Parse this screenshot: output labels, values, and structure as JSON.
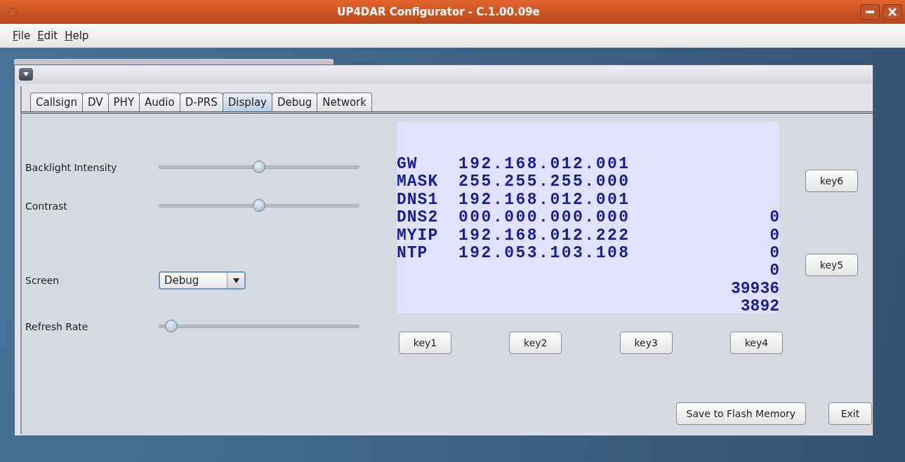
{
  "window": {
    "title": "UP4DAR Configurator - C.1.00.09e"
  },
  "menu": [
    "File",
    "Edit",
    "Help"
  ],
  "tabs": [
    {
      "label": "Callsign",
      "selected": false
    },
    {
      "label": "DV",
      "selected": false
    },
    {
      "label": "PHY",
      "selected": false
    },
    {
      "label": "Audio",
      "selected": false
    },
    {
      "label": "D-PRS",
      "selected": false
    },
    {
      "label": "Display",
      "selected": true
    },
    {
      "label": "Debug",
      "selected": false
    },
    {
      "label": "Network",
      "selected": false
    }
  ],
  "settings": [
    {
      "kind": "slider",
      "label": "Backlight Intensity",
      "level": 0.5
    },
    {
      "kind": "slider",
      "label": "Contrast",
      "level": 0.5
    },
    {
      "kind": "dropdown",
      "label": "Screen",
      "value": "Debug"
    },
    {
      "kind": "slider",
      "label": "Refresh Rate",
      "level": 0.03
    }
  ],
  "lcd": {
    "lines": [
      {
        "label": "GW",
        "address": "192.168.012.001"
      },
      {
        "label": "MASK",
        "address": "255.255.255.000"
      },
      {
        "label": "DNS1",
        "address": "192.168.012.001"
      },
      {
        "label": "DNS2",
        "address": "000.000.000.000",
        "value": "0"
      },
      {
        "label": "MYIP",
        "address": "192.168.012.222",
        "value": "0"
      },
      {
        "label": "NTP",
        "address": "192.053.103.108",
        "value": "0"
      },
      {
        "value": "0"
      },
      {
        "value": "39936"
      },
      {
        "value": "3892"
      }
    ]
  },
  "bottom_keys": [
    "key1",
    "key2",
    "key3",
    "key4"
  ],
  "side_keys": [
    "key6",
    "key5"
  ],
  "buttons": [
    "Save to Flash Memory",
    "Exit"
  ]
}
